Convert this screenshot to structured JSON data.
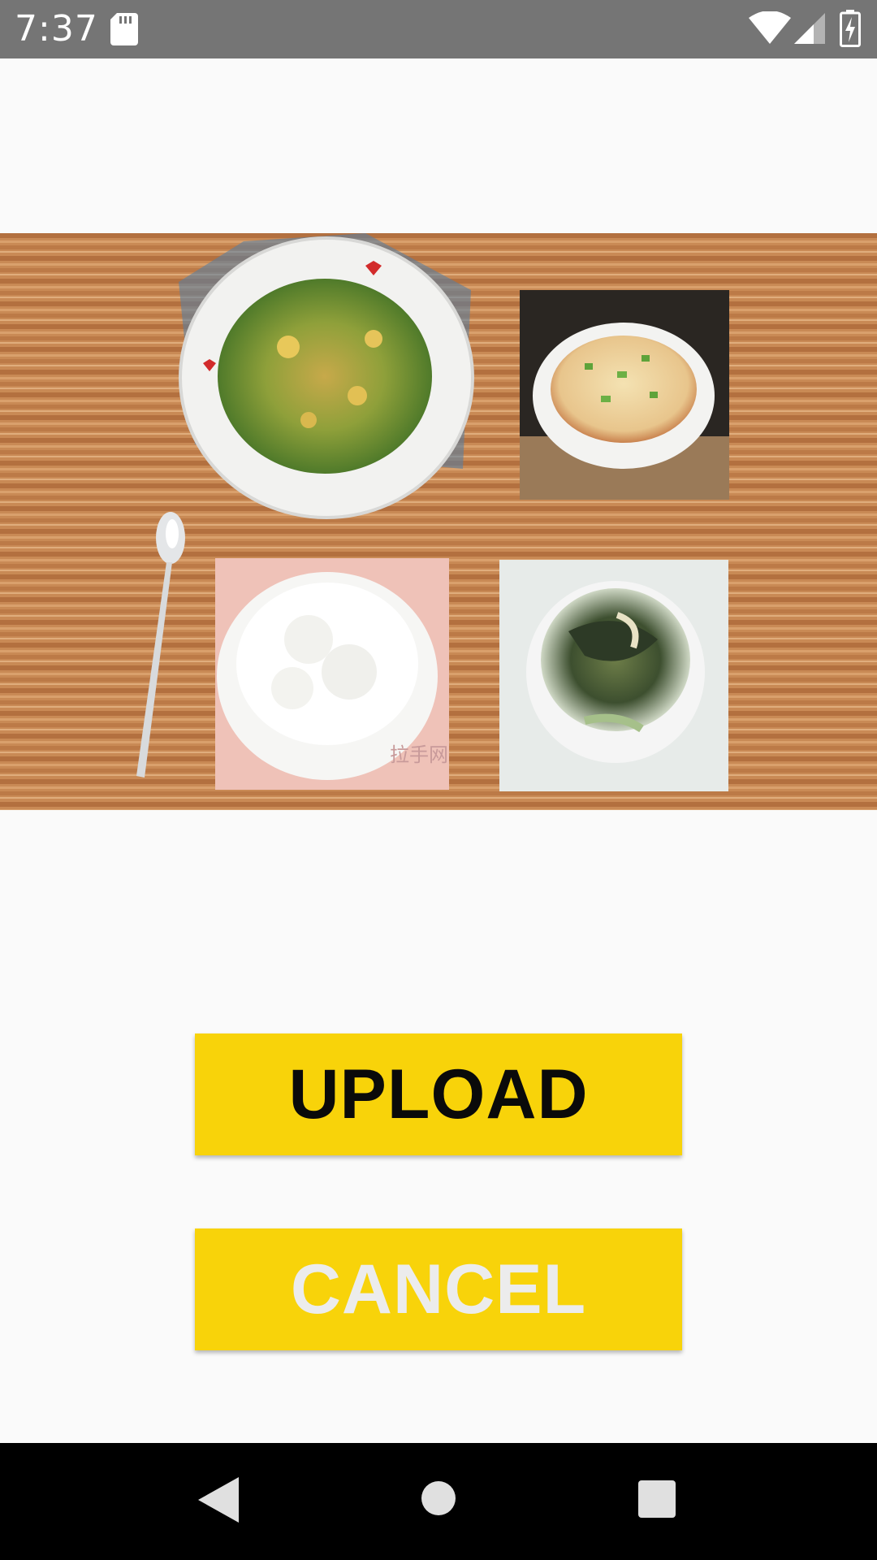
{
  "status_bar": {
    "time": "7:37",
    "icons": [
      "sd-card-icon",
      "wifi-icon",
      "cell-signal-icon",
      "battery-charging-icon"
    ]
  },
  "meal_image": {
    "description_icon": "meal-photo",
    "items": [
      "scrambled-eggs-with-chives",
      "steamed-egg-custard",
      "rice-bowl",
      "seaweed-egg-soup",
      "spoon"
    ]
  },
  "actions": {
    "upload_label": "UPLOAD",
    "cancel_label": "CANCEL"
  },
  "nav_bar": {
    "icons": [
      "back-icon",
      "home-icon",
      "recents-icon"
    ]
  },
  "colors": {
    "status_bar": "#757575",
    "button": "#f8d30a",
    "upload_text": "#0a0a0a",
    "cancel_text": "#ececec",
    "nav_bar": "#000000",
    "background": "#fafafa"
  }
}
